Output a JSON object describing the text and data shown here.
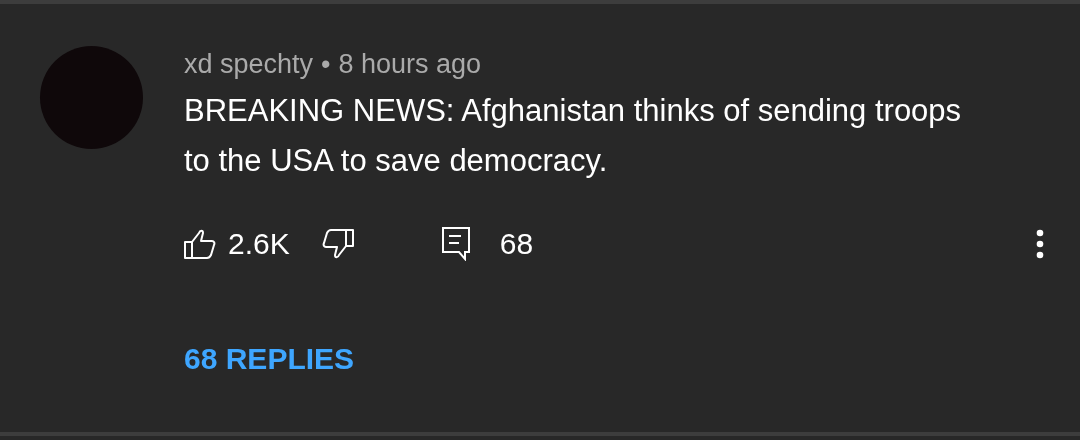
{
  "comment": {
    "author": "xd spechty",
    "separator": "•",
    "time": "8 hours ago",
    "text": "BREAKING NEWS: Afghanistan thinks of sending troops to the USA to save democracy.",
    "likes": "2.6K",
    "reply_count": "68",
    "replies_link": "68 REPLIES"
  }
}
